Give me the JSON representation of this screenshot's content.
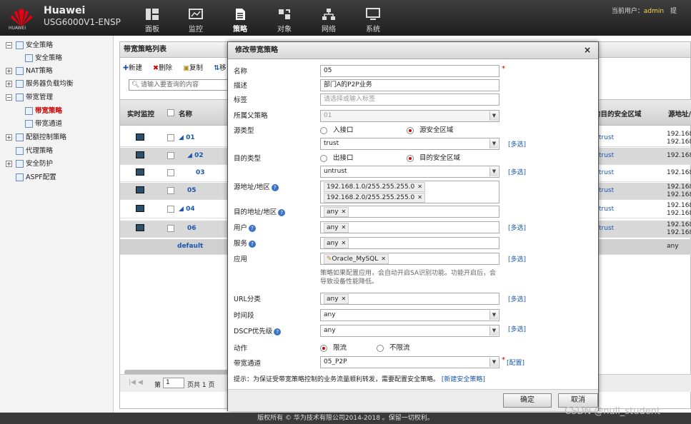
{
  "header": {
    "brand_line1": "Huawei",
    "brand_line2": "USG6000V1-ENSP",
    "logo_text": "HUAWEI",
    "nav": [
      {
        "label": "面板",
        "icon": "dashboard-icon"
      },
      {
        "label": "监控",
        "icon": "monitor-chart-icon"
      },
      {
        "label": "策略",
        "icon": "policy-document-icon"
      },
      {
        "label": "对象",
        "icon": "object-icon"
      },
      {
        "label": "网络",
        "icon": "network-icon"
      },
      {
        "label": "系统",
        "icon": "system-computer-icon"
      }
    ],
    "user_label": "当前用户：",
    "user_name": "admin",
    "user_extra": "提"
  },
  "sidebar": {
    "items": [
      {
        "label": "安全策略"
      },
      {
        "label": "安全策略"
      },
      {
        "label": "NAT策略"
      },
      {
        "label": "服务器负载均衡"
      },
      {
        "label": "带宽管理"
      },
      {
        "label": "带宽策略"
      },
      {
        "label": "带宽通道"
      },
      {
        "label": "配额控制策略"
      },
      {
        "label": "代理策略"
      },
      {
        "label": "安全防护"
      },
      {
        "label": "ASPF配置"
      }
    ]
  },
  "list": {
    "title": "带宽策略列表",
    "toolbar": {
      "new": "新建",
      "delete": "删除",
      "copy": "复制",
      "move": "移"
    },
    "search_placeholder": "请输入要查询的内容",
    "columns": {
      "monitor": "实时监控",
      "name": "名称",
      "zone": "的目的安全区域",
      "src": "源地址/"
    },
    "rows": [
      {
        "name": "01",
        "zone": "trust",
        "src1": "192.168",
        "src2": "192.168"
      },
      {
        "name": "02",
        "zone": "trust",
        "src1": "192.168",
        "src2": ""
      },
      {
        "name": "03",
        "zone": "trust",
        "src1": "192.168",
        "src2": ""
      },
      {
        "name": "05",
        "zone": "trust",
        "src1": "192.168",
        "src2": "192.168"
      },
      {
        "name": "04",
        "zone": "trust",
        "src1": "192.168",
        "src2": "192.168"
      },
      {
        "name": "06",
        "zone": "trust",
        "src1": "192.168",
        "src2": "192.168"
      }
    ],
    "default_row": {
      "name": "default",
      "src": "any"
    },
    "pager": {
      "page_prefix": "第",
      "page_value": "1",
      "page_suffix": "页共 1 页"
    }
  },
  "dialog": {
    "title": "修改带宽策略",
    "close": "×",
    "fields": {
      "name": {
        "label": "名称",
        "value": "05"
      },
      "desc": {
        "label": "描述",
        "value": "部门A的P2P业务"
      },
      "tag": {
        "label": "标签",
        "placeholder": "请选择或输入标签"
      },
      "parent": {
        "label": "所属父策略",
        "value": "01"
      },
      "src_type": {
        "label": "源类型",
        "opt1": "入接口",
        "opt2": "源安全区域"
      },
      "src_zone": {
        "value": "trust"
      },
      "dst_type": {
        "label": "目的类型",
        "opt1": "出接口",
        "opt2": "目的安全区域"
      },
      "dst_zone": {
        "value": "untrust"
      },
      "src_addr": {
        "label": "源地址/地区",
        "tags": [
          "192.168.1.0/255.255.255.0",
          "192.168.2.0/255.255.255.0"
        ]
      },
      "dst_addr": {
        "label": "目的地址/地区",
        "tag": "any"
      },
      "user": {
        "label": "用户",
        "tag": "any"
      },
      "service": {
        "label": "服务",
        "tag": "any"
      },
      "app": {
        "label": "应用",
        "tag": "Oracle_MySQL"
      },
      "app_hint": "策略如果配置应用，会自动开启SA识别功能。功能开启后，会导致设备性能降低。",
      "url": {
        "label": "URL分类",
        "tag": "any"
      },
      "time": {
        "label": "时间段",
        "value": "any"
      },
      "dscp": {
        "label": "DSCP优先级",
        "value": "any"
      },
      "action": {
        "label": "动作",
        "opt1": "限流",
        "opt2": "不限流"
      },
      "channel": {
        "label": "带宽通道",
        "value": "05_P2P"
      }
    },
    "more": "[多选]",
    "config": "[配置]",
    "tip_text": "提示：为保证受带宽策略控制的业务流量顺利转发，需要配置安全策略。",
    "tip_link": "[新建安全策略]",
    "ok": "确定",
    "cancel": "取消"
  },
  "footer": "版权所有 © 华为技术有限公司2014-2018 。保留一切权利。",
  "watermark": "CSDN @null_student"
}
